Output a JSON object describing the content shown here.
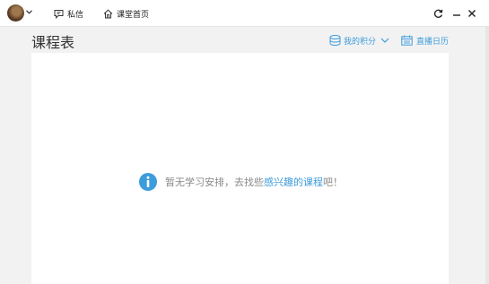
{
  "titlebar": {
    "messages_label": "私信",
    "home_label": "课堂首页"
  },
  "header": {
    "title": "课程表",
    "points_label": "我的积分",
    "calendar_label": "直播日历"
  },
  "empty_state": {
    "prefix": "暂无学习安排，去找些",
    "link": "感兴趣的课程",
    "suffix": "吧！"
  },
  "colors": {
    "accent": "#3d9cdb",
    "background": "#f2f2f2",
    "panel": "#ffffff"
  },
  "icons": [
    "chevron-down-icon",
    "message-icon",
    "home-icon",
    "refresh-icon",
    "minimize-icon",
    "close-icon",
    "coins-icon",
    "calendar-icon",
    "info-icon"
  ]
}
